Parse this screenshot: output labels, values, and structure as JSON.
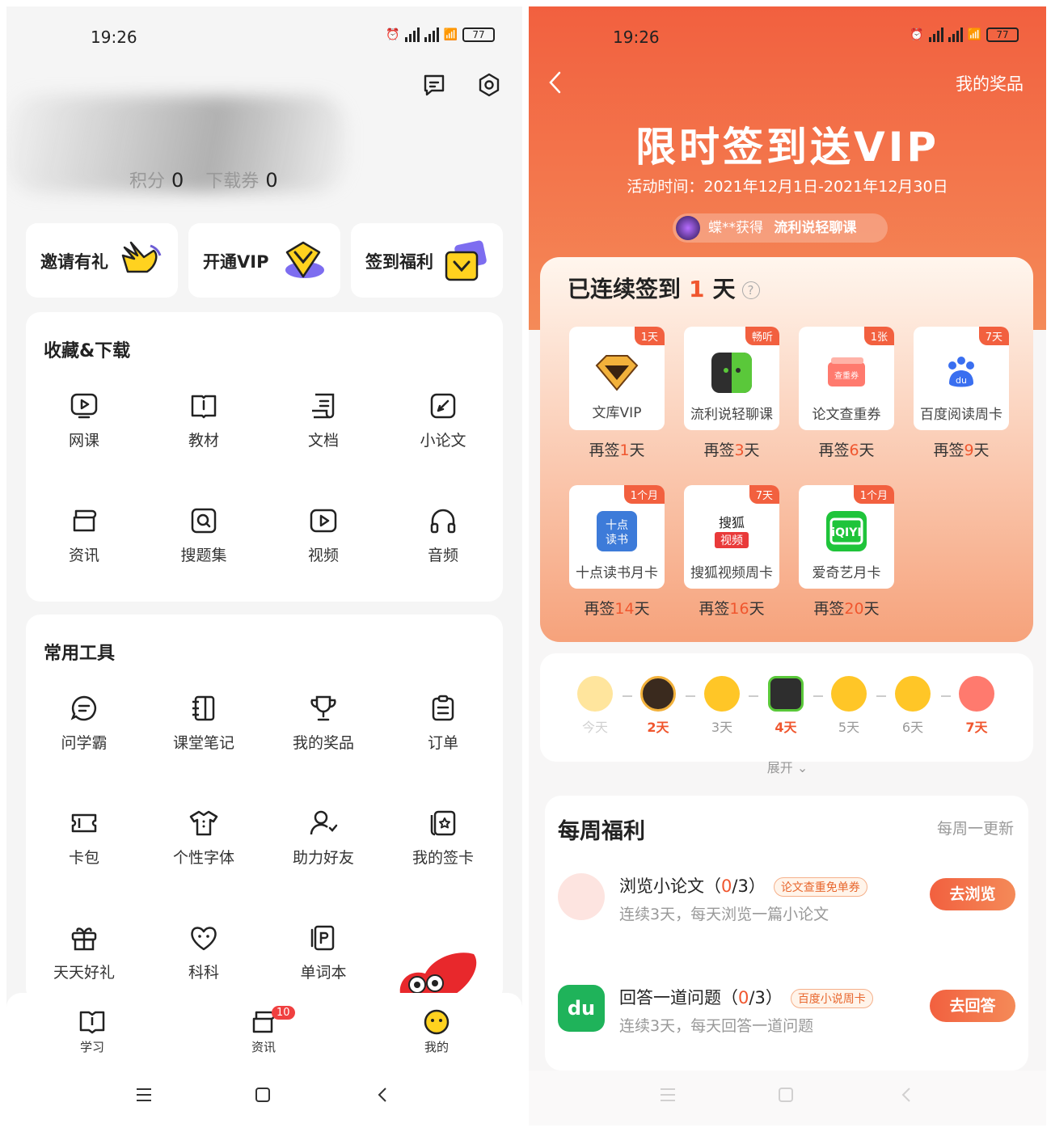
{
  "left": {
    "status": {
      "time": "19:26",
      "battery": "77"
    },
    "points_label": "积分",
    "points_value": "0",
    "coupon_label": "下载券",
    "coupon_value": "0",
    "quick": [
      {
        "label": "邀请有礼",
        "icon": "waving-hand-icon"
      },
      {
        "label": "开通VIP",
        "icon": "vip-diamond-icon"
      },
      {
        "label": "签到福利",
        "icon": "checkin-card-icon"
      }
    ],
    "collect": {
      "title": "收藏&下载",
      "items": [
        {
          "label": "网课",
          "icon": "play-icon"
        },
        {
          "label": "教材",
          "icon": "book-icon"
        },
        {
          "label": "文档",
          "icon": "document-icon"
        },
        {
          "label": "小论文",
          "icon": "pen-icon"
        },
        {
          "label": "资讯",
          "icon": "news-icon"
        },
        {
          "label": "搜题集",
          "icon": "search-icon"
        },
        {
          "label": "视频",
          "icon": "video-icon"
        },
        {
          "label": "音频",
          "icon": "headphones-icon"
        }
      ]
    },
    "tools": {
      "title": "常用工具",
      "items": [
        {
          "label": "问学霸",
          "icon": "chat-icon"
        },
        {
          "label": "课堂笔记",
          "icon": "notebook-icon"
        },
        {
          "label": "我的奖品",
          "icon": "trophy-icon"
        },
        {
          "label": "订单",
          "icon": "clipboard-icon"
        },
        {
          "label": "卡包",
          "icon": "ticket-icon"
        },
        {
          "label": "个性字体",
          "icon": "shirt-icon"
        },
        {
          "label": "助力好友",
          "icon": "user-icon"
        },
        {
          "label": "我的签卡",
          "icon": "card-icon"
        },
        {
          "label": "天天好礼",
          "icon": "gift-icon"
        },
        {
          "label": "科科",
          "icon": "heart-icon"
        },
        {
          "label": "单词本",
          "icon": "wordbook-icon"
        }
      ]
    },
    "tabs": [
      {
        "label": "学习",
        "icon": "book-tab-icon"
      },
      {
        "label": "资讯",
        "icon": "news-tab-icon",
        "badge": "10"
      },
      {
        "label": "我的",
        "icon": "smile-tab-icon"
      }
    ]
  },
  "right": {
    "status": {
      "time": "19:26",
      "battery": "77"
    },
    "my_prizes": "我的奖品",
    "title": "限时签到送VIP",
    "period": "活动时间：2021年12月1日-2021年12月30日",
    "winner_name": "蝶**获得",
    "winner_prize": "流利说轻聊课",
    "streak_prefix": "已连续签到",
    "streak_days": "1",
    "streak_suffix": "天",
    "prizes": [
      {
        "name": "文库VIP",
        "tag": "1天",
        "again_pre": "再签",
        "again_n": "1",
        "again_suf": "天",
        "icon": "diamond-icon"
      },
      {
        "name": "流利说轻聊课",
        "tag": "畅听",
        "again_pre": "再签",
        "again_n": "3",
        "again_suf": "天",
        "icon": "liulishuo-icon"
      },
      {
        "name": "论文查重券",
        "tag": "1张",
        "again_pre": "再签",
        "again_n": "6",
        "again_suf": "天",
        "icon": "coupon-icon"
      },
      {
        "name": "百度阅读周卡",
        "tag": "7天",
        "again_pre": "再签",
        "again_n": "9",
        "again_suf": "天",
        "icon": "baidu-icon"
      },
      {
        "name": "十点读书月卡",
        "tag": "1个月",
        "again_pre": "再签",
        "again_n": "14",
        "again_suf": "天",
        "icon": "shidian-icon"
      },
      {
        "name": "搜狐视频周卡",
        "tag": "7天",
        "again_pre": "再签",
        "again_n": "16",
        "again_suf": "天",
        "icon": "sohu-icon"
      },
      {
        "name": "爱奇艺月卡",
        "tag": "1个月",
        "again_pre": "再签",
        "again_n": "20",
        "again_suf": "天",
        "icon": "iqiyi-icon"
      }
    ],
    "coupon_text": "查重券",
    "days": [
      "今天",
      "2天",
      "3天",
      "4天",
      "5天",
      "6天",
      "7天"
    ],
    "expand": "展开",
    "weekly_title": "每周福利",
    "weekly_update": "每周一更新",
    "tasks": [
      {
        "title": "浏览小论文",
        "progress": "0",
        "total": "/3",
        "chip": "论文查重免单券",
        "sub": "连续3天，每天浏览一篇小论文",
        "btn": "去浏览"
      },
      {
        "title": "回答一道问题",
        "progress": "0",
        "total": "/3",
        "chip": "百度小说周卡",
        "sub": "连续3天，每天回答一道问题",
        "btn": "去回答"
      }
    ],
    "accent": "#F2603F"
  }
}
